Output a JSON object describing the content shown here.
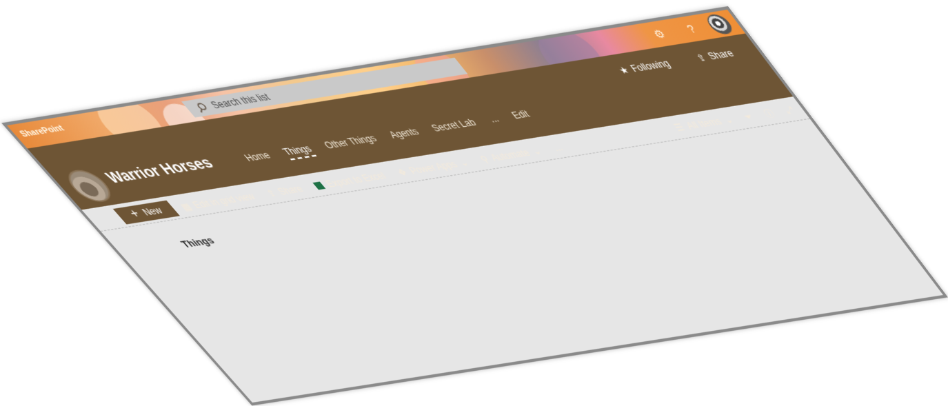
{
  "suite_bar": {
    "brand": "SharePoint",
    "search_placeholder": "Search this list"
  },
  "hub": {
    "site_title": "Warrior Horses",
    "nav": [
      "Home",
      "Things",
      "Other Things",
      "Agents",
      "Secret Lab",
      "...",
      "Edit"
    ],
    "active_nav": "Things",
    "following_label": "Following",
    "share_label": "Share"
  },
  "command_bar": {
    "items": [
      "Edit in grid view",
      "Share",
      "Export to Excel",
      "Power Apps",
      "Automate",
      "..."
    ],
    "view_name": "All Items"
  },
  "toolbar": {
    "new_label": "New"
  },
  "list": {
    "title": "Things"
  },
  "colors": {
    "accent": "#6e5535",
    "suite_bar": "#ef8f36",
    "page_background": "#e6e6e6"
  },
  "icons": [
    "search-icon",
    "settings-icon",
    "help-icon",
    "star-icon",
    "share-icon",
    "grid-icon",
    "excel-icon",
    "power-apps-icon",
    "automate-icon",
    "view-icon",
    "filter-icon",
    "info-icon",
    "expand-icon",
    "plus-icon"
  ]
}
